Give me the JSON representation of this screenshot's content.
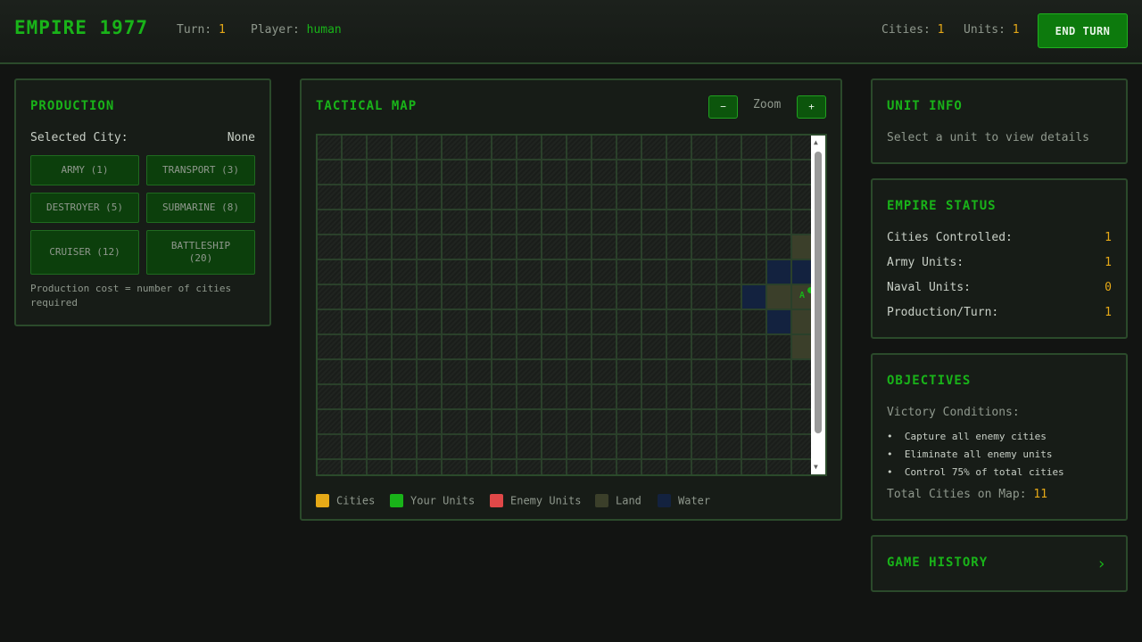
{
  "header": {
    "title": "EMPIRE 1977",
    "turn_label": "Turn:",
    "turn_value": "1",
    "player_label": "Player:",
    "player_value": "human",
    "cities_label": "Cities:",
    "cities_value": "1",
    "units_label": "Units:",
    "units_value": "1",
    "end_turn_label": "END TURN"
  },
  "production": {
    "title": "PRODUCTION",
    "selected_city_label": "Selected City:",
    "selected_city_value": "None",
    "buttons": [
      "ARMY (1)",
      "TRANSPORT (3)",
      "DESTROYER (5)",
      "SUBMARINE (8)",
      "CRUISER (12)",
      "BATTLESHIP (20)"
    ],
    "note": "Production cost = number of cities required"
  },
  "map": {
    "title": "TACTICAL MAP",
    "zoom_label": "Zoom",
    "zoom_out": "−",
    "zoom_in": "+",
    "columns": 20,
    "rows": 14,
    "land_cells": [
      [
        19,
        4
      ],
      [
        18,
        6
      ],
      [
        19,
        6
      ],
      [
        19,
        7
      ],
      [
        19,
        8
      ]
    ],
    "water_cells": [
      [
        18,
        5
      ],
      [
        19,
        5
      ],
      [
        17,
        6
      ],
      [
        18,
        7
      ]
    ],
    "unit": {
      "col": 19,
      "row": 6,
      "letter": "A",
      "owner": "player"
    },
    "legend": [
      {
        "label": "Cities",
        "color": "#e6a917"
      },
      {
        "label": "Your Units",
        "color": "#19b319"
      },
      {
        "label": "Enemy Units",
        "color": "#e04848"
      },
      {
        "label": "Land",
        "color": "#3b3f2a"
      },
      {
        "label": "Water",
        "color": "#13223f"
      }
    ]
  },
  "unit_info": {
    "title": "UNIT INFO",
    "placeholder": "Select a unit to view details"
  },
  "empire_status": {
    "title": "EMPIRE STATUS",
    "rows": [
      {
        "label": "Cities Controlled:",
        "value": "1"
      },
      {
        "label": "Army Units:",
        "value": "1"
      },
      {
        "label": "Naval Units:",
        "value": "0"
      },
      {
        "label": "Production/Turn:",
        "value": "1"
      }
    ]
  },
  "objectives": {
    "title": "OBJECTIVES",
    "subtitle": "Victory Conditions:",
    "items": [
      "Capture all enemy cities",
      "Eliminate all enemy units",
      "Control 75% of total cities"
    ],
    "total_label": "Total Cities on Map:",
    "total_value": "11"
  },
  "history": {
    "title": "GAME HISTORY"
  },
  "colors": {
    "accent": "#19b319",
    "highlight": "#e6a917",
    "border": "#2b4a2b"
  }
}
